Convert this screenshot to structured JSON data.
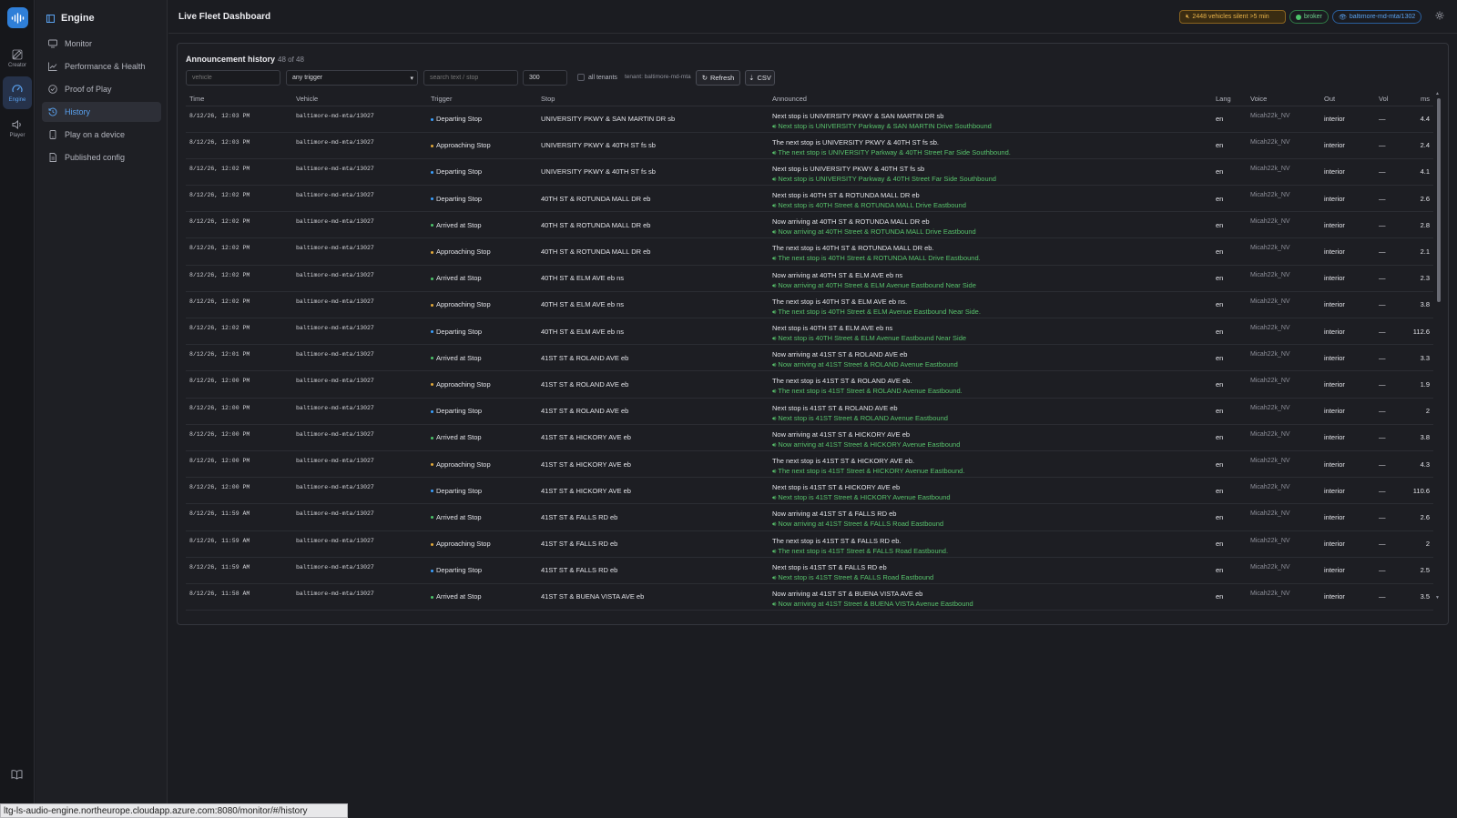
{
  "rail": {
    "items": [
      {
        "label": "Creator",
        "icon": "edit-icon"
      },
      {
        "label": "Engine",
        "icon": "gauge-icon"
      },
      {
        "label": "Player",
        "icon": "speaker-icon"
      }
    ]
  },
  "sidebar": {
    "title": "Engine",
    "items": [
      {
        "label": "Monitor",
        "icon": "monitor-icon"
      },
      {
        "label": "Performance & Health",
        "icon": "chart-icon"
      },
      {
        "label": "Proof of Play",
        "icon": "check-circle-icon"
      },
      {
        "label": "History",
        "icon": "history-icon"
      },
      {
        "label": "Play on a device",
        "icon": "device-icon"
      },
      {
        "label": "Published config",
        "icon": "file-icon"
      }
    ]
  },
  "header": {
    "title": "Live Fleet Dashboard",
    "silent_badge": "2448 vehicles silent >5 min",
    "broker_badge": "broker",
    "tenant_badge": "baltimore-md-mta/13027"
  },
  "panel": {
    "title": "Announcement history",
    "count": "48 of 48",
    "filters": {
      "vehicle_placeholder": "vehicle",
      "trigger_value": "any trigger",
      "search_placeholder": "search text / stop",
      "limit_value": "300",
      "all_tenants_label": "all tenants",
      "tenant_label": "tenant: baltimore-md-mta",
      "refresh_label": "Refresh",
      "csv_label": "CSV"
    },
    "columns": [
      "Time",
      "Vehicle",
      "Trigger",
      "Stop",
      "Announced",
      "Lang",
      "Voice",
      "Out",
      "Vol",
      "ms"
    ]
  },
  "colors": {
    "departing": "#3aa0ff",
    "approaching": "#e2a93a",
    "arrived": "#4cc46a"
  },
  "rows": [
    {
      "time": "8/12/26, 12:03 PM",
      "vehicle": "baltimore-md-mta/13027",
      "trigger": "Departing Stop",
      "trigger_kind": "departing",
      "stop": "UNIVERSITY PKWY & SAN MARTIN DR sb",
      "announced": "Next stop is UNIVERSITY PKWY & SAN MARTIN DR sb",
      "spoken": "Next stop is UNIVERSITY Parkway & SAN MARTIN Drive Southbound",
      "lang": "en",
      "voice": "Micah22k_NV",
      "out": "interior",
      "vol": "—",
      "ms": "4.4"
    },
    {
      "time": "8/12/26, 12:03 PM",
      "vehicle": "baltimore-md-mta/13027",
      "trigger": "Approaching Stop",
      "trigger_kind": "approaching",
      "stop": "UNIVERSITY PKWY & 40TH ST fs sb",
      "announced": "The next stop is UNIVERSITY PKWY & 40TH ST fs sb.",
      "spoken": "The next stop is UNIVERSITY Parkway & 40TH Street Far Side Southbound.",
      "lang": "en",
      "voice": "Micah22k_NV",
      "out": "interior",
      "vol": "—",
      "ms": "2.4"
    },
    {
      "time": "8/12/26, 12:02 PM",
      "vehicle": "baltimore-md-mta/13027",
      "trigger": "Departing Stop",
      "trigger_kind": "departing",
      "stop": "UNIVERSITY PKWY & 40TH ST fs sb",
      "announced": "Next stop is UNIVERSITY PKWY & 40TH ST fs sb",
      "spoken": "Next stop is UNIVERSITY Parkway & 40TH Street Far Side Southbound",
      "lang": "en",
      "voice": "Micah22k_NV",
      "out": "interior",
      "vol": "—",
      "ms": "4.1"
    },
    {
      "time": "8/12/26, 12:02 PM",
      "vehicle": "baltimore-md-mta/13027",
      "trigger": "Departing Stop",
      "trigger_kind": "departing",
      "stop": "40TH ST & ROTUNDA MALL DR eb",
      "announced": "Next stop is 40TH ST & ROTUNDA MALL DR eb",
      "spoken": "Next stop is 40TH Street & ROTUNDA MALL Drive Eastbound",
      "lang": "en",
      "voice": "Micah22k_NV",
      "out": "interior",
      "vol": "—",
      "ms": "2.6"
    },
    {
      "time": "8/12/26, 12:02 PM",
      "vehicle": "baltimore-md-mta/13027",
      "trigger": "Arrived at Stop",
      "trigger_kind": "arrived",
      "stop": "40TH ST & ROTUNDA MALL DR eb",
      "announced": "Now arriving at 40TH ST & ROTUNDA MALL DR eb",
      "spoken": "Now arriving at 40TH Street & ROTUNDA MALL Drive Eastbound",
      "lang": "en",
      "voice": "Micah22k_NV",
      "out": "interior",
      "vol": "—",
      "ms": "2.8"
    },
    {
      "time": "8/12/26, 12:02 PM",
      "vehicle": "baltimore-md-mta/13027",
      "trigger": "Approaching Stop",
      "trigger_kind": "approaching",
      "stop": "40TH ST & ROTUNDA MALL DR eb",
      "announced": "The next stop is 40TH ST & ROTUNDA MALL DR eb.",
      "spoken": "The next stop is 40TH Street & ROTUNDA MALL Drive Eastbound.",
      "lang": "en",
      "voice": "Micah22k_NV",
      "out": "interior",
      "vol": "—",
      "ms": "2.1"
    },
    {
      "time": "8/12/26, 12:02 PM",
      "vehicle": "baltimore-md-mta/13027",
      "trigger": "Arrived at Stop",
      "trigger_kind": "arrived",
      "stop": "40TH ST & ELM AVE eb ns",
      "announced": "Now arriving at 40TH ST & ELM AVE eb ns",
      "spoken": "Now arriving at 40TH Street & ELM Avenue Eastbound Near Side",
      "lang": "en",
      "voice": "Micah22k_NV",
      "out": "interior",
      "vol": "—",
      "ms": "2.3"
    },
    {
      "time": "8/12/26, 12:02 PM",
      "vehicle": "baltimore-md-mta/13027",
      "trigger": "Approaching Stop",
      "trigger_kind": "approaching",
      "stop": "40TH ST & ELM AVE eb ns",
      "announced": "The next stop is 40TH ST & ELM AVE eb ns.",
      "spoken": "The next stop is 40TH Street & ELM Avenue Eastbound Near Side.",
      "lang": "en",
      "voice": "Micah22k_NV",
      "out": "interior",
      "vol": "—",
      "ms": "3.8"
    },
    {
      "time": "8/12/26, 12:02 PM",
      "vehicle": "baltimore-md-mta/13027",
      "trigger": "Departing Stop",
      "trigger_kind": "departing",
      "stop": "40TH ST & ELM AVE eb ns",
      "announced": "Next stop is 40TH ST & ELM AVE eb ns",
      "spoken": "Next stop is 40TH Street & ELM Avenue Eastbound Near Side",
      "lang": "en",
      "voice": "Micah22k_NV",
      "out": "interior",
      "vol": "—",
      "ms": "112.6"
    },
    {
      "time": "8/12/26, 12:01 PM",
      "vehicle": "baltimore-md-mta/13027",
      "trigger": "Arrived at Stop",
      "trigger_kind": "arrived",
      "stop": "41ST ST & ROLAND AVE eb",
      "announced": "Now arriving at 41ST ST & ROLAND AVE eb",
      "spoken": "Now arriving at 41ST Street & ROLAND Avenue Eastbound",
      "lang": "en",
      "voice": "Micah22k_NV",
      "out": "interior",
      "vol": "—",
      "ms": "3.3"
    },
    {
      "time": "8/12/26, 12:00 PM",
      "vehicle": "baltimore-md-mta/13027",
      "trigger": "Approaching Stop",
      "trigger_kind": "approaching",
      "stop": "41ST ST & ROLAND AVE eb",
      "announced": "The next stop is 41ST ST & ROLAND AVE eb.",
      "spoken": "The next stop is 41ST Street & ROLAND Avenue Eastbound.",
      "lang": "en",
      "voice": "Micah22k_NV",
      "out": "interior",
      "vol": "—",
      "ms": "1.9"
    },
    {
      "time": "8/12/26, 12:00 PM",
      "vehicle": "baltimore-md-mta/13027",
      "trigger": "Departing Stop",
      "trigger_kind": "departing",
      "stop": "41ST ST & ROLAND AVE eb",
      "announced": "Next stop is 41ST ST & ROLAND AVE eb",
      "spoken": "Next stop is 41ST Street & ROLAND Avenue Eastbound",
      "lang": "en",
      "voice": "Micah22k_NV",
      "out": "interior",
      "vol": "—",
      "ms": "2"
    },
    {
      "time": "8/12/26, 12:00 PM",
      "vehicle": "baltimore-md-mta/13027",
      "trigger": "Arrived at Stop",
      "trigger_kind": "arrived",
      "stop": "41ST ST & HICKORY AVE eb",
      "announced": "Now arriving at 41ST ST & HICKORY AVE eb",
      "spoken": "Now arriving at 41ST Street & HICKORY Avenue Eastbound",
      "lang": "en",
      "voice": "Micah22k_NV",
      "out": "interior",
      "vol": "—",
      "ms": "3.8"
    },
    {
      "time": "8/12/26, 12:00 PM",
      "vehicle": "baltimore-md-mta/13027",
      "trigger": "Approaching Stop",
      "trigger_kind": "approaching",
      "stop": "41ST ST & HICKORY AVE eb",
      "announced": "The next stop is 41ST ST & HICKORY AVE eb.",
      "spoken": "The next stop is 41ST Street & HICKORY Avenue Eastbound.",
      "lang": "en",
      "voice": "Micah22k_NV",
      "out": "interior",
      "vol": "—",
      "ms": "4.3"
    },
    {
      "time": "8/12/26, 12:00 PM",
      "vehicle": "baltimore-md-mta/13027",
      "trigger": "Departing Stop",
      "trigger_kind": "departing",
      "stop": "41ST ST & HICKORY AVE eb",
      "announced": "Next stop is 41ST ST & HICKORY AVE eb",
      "spoken": "Next stop is 41ST Street & HICKORY Avenue Eastbound",
      "lang": "en",
      "voice": "Micah22k_NV",
      "out": "interior",
      "vol": "—",
      "ms": "110.6"
    },
    {
      "time": "8/12/26, 11:59 AM",
      "vehicle": "baltimore-md-mta/13027",
      "trigger": "Arrived at Stop",
      "trigger_kind": "arrived",
      "stop": "41ST ST & FALLS RD eb",
      "announced": "Now arriving at 41ST ST & FALLS RD eb",
      "spoken": "Now arriving at 41ST Street & FALLS Road Eastbound",
      "lang": "en",
      "voice": "Micah22k_NV",
      "out": "interior",
      "vol": "—",
      "ms": "2.6"
    },
    {
      "time": "8/12/26, 11:59 AM",
      "vehicle": "baltimore-md-mta/13027",
      "trigger": "Approaching Stop",
      "trigger_kind": "approaching",
      "stop": "41ST ST & FALLS RD eb",
      "announced": "The next stop is 41ST ST & FALLS RD eb.",
      "spoken": "The next stop is 41ST Street & FALLS Road Eastbound.",
      "lang": "en",
      "voice": "Micah22k_NV",
      "out": "interior",
      "vol": "—",
      "ms": "2"
    },
    {
      "time": "8/12/26, 11:59 AM",
      "vehicle": "baltimore-md-mta/13027",
      "trigger": "Departing Stop",
      "trigger_kind": "departing",
      "stop": "41ST ST & FALLS RD eb",
      "announced": "Next stop is 41ST ST & FALLS RD eb",
      "spoken": "Next stop is 41ST Street & FALLS Road Eastbound",
      "lang": "en",
      "voice": "Micah22k_NV",
      "out": "interior",
      "vol": "—",
      "ms": "2.5"
    },
    {
      "time": "8/12/26, 11:58 AM",
      "vehicle": "baltimore-md-mta/13027",
      "trigger": "Arrived at Stop",
      "trigger_kind": "arrived",
      "stop": "41ST ST & BUENA VISTA AVE eb",
      "announced": "Now arriving at 41ST ST & BUENA VISTA AVE eb",
      "spoken": "Now arriving at 41ST Street & BUENA VISTA Avenue Eastbound",
      "lang": "en",
      "voice": "Micah22k_NV",
      "out": "interior",
      "vol": "—",
      "ms": "3.5"
    }
  ],
  "statusbar": {
    "url": "ltg-ls-audio-engine.northeurope.cloudapp.azure.com:8080/monitor/#/history"
  }
}
